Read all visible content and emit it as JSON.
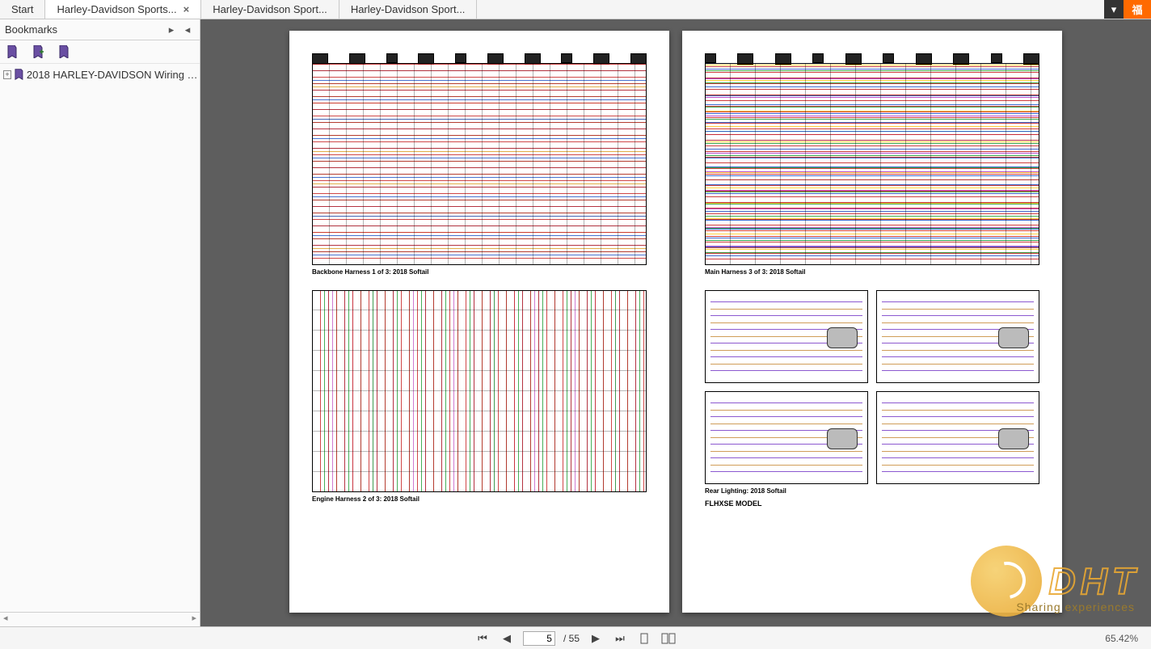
{
  "tabs": [
    {
      "label": "Start",
      "active": false,
      "closable": false
    },
    {
      "label": "Harley-Davidson Sports...",
      "active": true,
      "closable": true
    },
    {
      "label": "Harley-Davidson Sport...",
      "active": false,
      "closable": false
    },
    {
      "label": "Harley-Davidson Sport...",
      "active": false,
      "closable": false
    }
  ],
  "tabstrip": {
    "orange_label": "福"
  },
  "sidebar": {
    "title": "Bookmarks",
    "tree": [
      {
        "label": "2018 HARLEY-DAVIDSON Wiring Diag…",
        "expandable": true
      }
    ]
  },
  "pages": {
    "left": {
      "caption_top": "Backbone Harness 1 of 3: 2018 Softail",
      "caption_bottom": "Engine Harness 2 of 3: 2018 Softail"
    },
    "right": {
      "caption_top": "Main Harness 3 of 3: 2018 Softail",
      "caption_mid": "Rear Lighting: 2018 Softail",
      "caption_model": "FLHXSE MODEL"
    }
  },
  "nav": {
    "current_page": "5",
    "total_pages": "55",
    "zoom": "65.42%"
  },
  "watermark": {
    "text": "DHT",
    "sub": "Sharing experiences"
  }
}
